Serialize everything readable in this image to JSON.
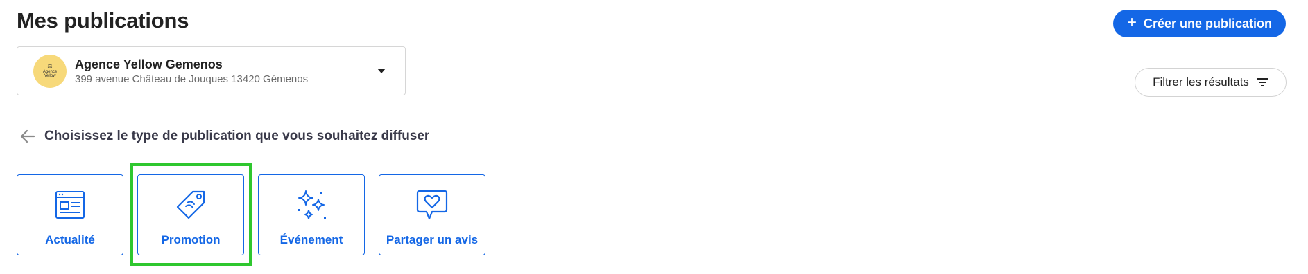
{
  "page": {
    "title": "Mes publications"
  },
  "header": {
    "create_label": "Créer une publication",
    "create_icon": "plus-icon"
  },
  "agency": {
    "name": "Agence Yellow Gemenos",
    "address": "399 avenue Château de Jouques 13420 Gémenos",
    "avatar_line1": "Agence",
    "avatar_line2": "Yellow",
    "avatar_color": "#f7d97a"
  },
  "filter": {
    "label": "Filtrer les résultats",
    "icon": "filter-icon"
  },
  "chooser": {
    "prompt": "Choisissez le type de publication que vous souhaitez diffuser",
    "types": [
      {
        "label": "Actualité",
        "icon": "news-icon"
      },
      {
        "label": "Promotion",
        "icon": "price-tag-icon",
        "highlighted": true
      },
      {
        "label": "Événement",
        "icon": "sparkles-icon"
      },
      {
        "label": "Partager un avis",
        "icon": "heart-speech-bubble-icon"
      }
    ]
  },
  "colors": {
    "accent": "#1467e6",
    "highlight": "#2fc72f"
  }
}
